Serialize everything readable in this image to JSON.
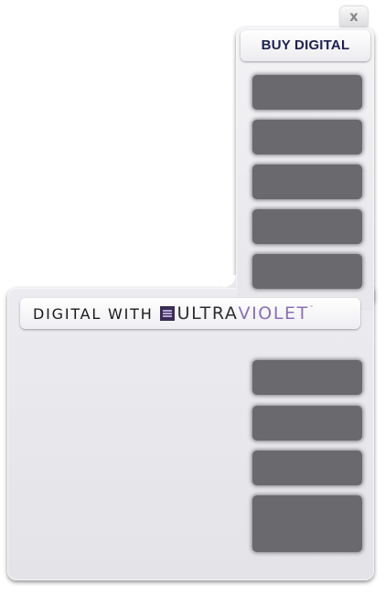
{
  "close_button": {
    "label": "x",
    "icon": "close-icon"
  },
  "buy_digital": {
    "label": "BUY DIGITAL"
  },
  "uv_banner": {
    "prefix": "DIGITAL WITH",
    "logo_icon": "ultraviolet-logo-icon",
    "brand_part1": "ULTRA",
    "brand_part2": "VIOLET",
    "trademark": "™"
  },
  "colors": {
    "header_text": "#1d2150",
    "tile_fill": "#6a6a6e",
    "brand_violet": "#8a6fb8",
    "panel_bg": "#e8e8ec"
  },
  "tiles": {
    "top_group_count": 5,
    "bottom_group_count": 4
  }
}
